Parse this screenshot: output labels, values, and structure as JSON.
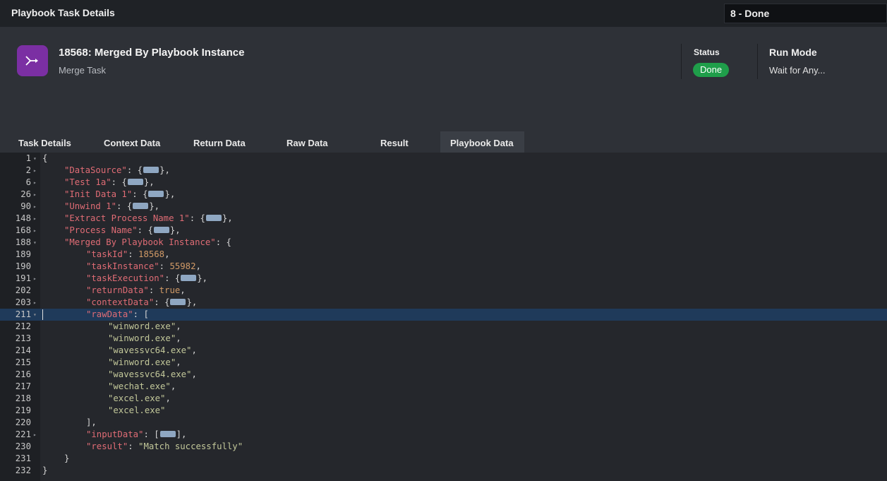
{
  "topbar": {
    "title": "Playbook Task Details",
    "run_selector": "8 - Done"
  },
  "task": {
    "title": "18568: Merged By Playbook Instance",
    "type": "Merge Task",
    "icon": "merge-icon",
    "icon_color": "#7b2fa3"
  },
  "status": {
    "label": "Status",
    "value": "Done",
    "color": "#1f9e4a"
  },
  "run_mode": {
    "label": "Run Mode",
    "value": "Wait for Any..."
  },
  "tabs": [
    {
      "label": "Task Details",
      "active": false
    },
    {
      "label": "Context Data",
      "active": false
    },
    {
      "label": "Return Data",
      "active": false
    },
    {
      "label": "Raw Data",
      "active": false
    },
    {
      "label": "Result",
      "active": false
    },
    {
      "label": "Playbook Data",
      "active": true
    }
  ],
  "editor": {
    "active_line": "211",
    "lines": [
      {
        "num": "1",
        "fold": "down"
      },
      {
        "num": "2",
        "fold": "right",
        "key": "\"DataSource\"",
        "collapsed": "{}"
      },
      {
        "num": "6",
        "fold": "right",
        "key": "\"Test 1a\"",
        "collapsed": "{}"
      },
      {
        "num": "26",
        "fold": "right",
        "key": "\"Init Data 1\"",
        "collapsed": "{}"
      },
      {
        "num": "90",
        "fold": "right",
        "key": "\"Unwind 1\"",
        "collapsed": "{}"
      },
      {
        "num": "148",
        "fold": "right",
        "key": "\"Extract Process Name 1\"",
        "collapsed": "{}"
      },
      {
        "num": "168",
        "fold": "right",
        "key": "\"Process Name\"",
        "collapsed": "{}"
      },
      {
        "num": "188",
        "fold": "down",
        "key": "\"Merged By Playbook Instance\"",
        "open": "{"
      },
      {
        "num": "189",
        "key": "\"taskId\"",
        "number": "18568"
      },
      {
        "num": "190",
        "key": "\"taskInstance\"",
        "number": "55982"
      },
      {
        "num": "191",
        "fold": "right",
        "key": "\"taskExecution\"",
        "collapsed": "{}"
      },
      {
        "num": "202",
        "key": "\"returnData\"",
        "number": "true"
      },
      {
        "num": "203",
        "fold": "right",
        "key": "\"contextData\"",
        "collapsed": "{}"
      },
      {
        "num": "211",
        "fold": "down",
        "key": "\"rawData\"",
        "open": "["
      },
      {
        "num": "212",
        "string": "\"winword.exe\""
      },
      {
        "num": "213",
        "string": "\"winword.exe\""
      },
      {
        "num": "214",
        "string": "\"wavessvc64.exe\""
      },
      {
        "num": "215",
        "string": "\"winword.exe\""
      },
      {
        "num": "216",
        "string": "\"wavessvc64.exe\""
      },
      {
        "num": "217",
        "string": "\"wechat.exe\""
      },
      {
        "num": "218",
        "string": "\"excel.exe\""
      },
      {
        "num": "219",
        "string": "\"excel.exe\""
      },
      {
        "num": "220",
        "close": "]"
      },
      {
        "num": "221",
        "fold": "right",
        "key": "\"inputData\"",
        "collapsed": "[]"
      },
      {
        "num": "230",
        "key": "\"result\"",
        "string": "\"Match successfully\""
      },
      {
        "num": "231",
        "close": "}"
      },
      {
        "num": "232",
        "close": "}"
      }
    ]
  }
}
